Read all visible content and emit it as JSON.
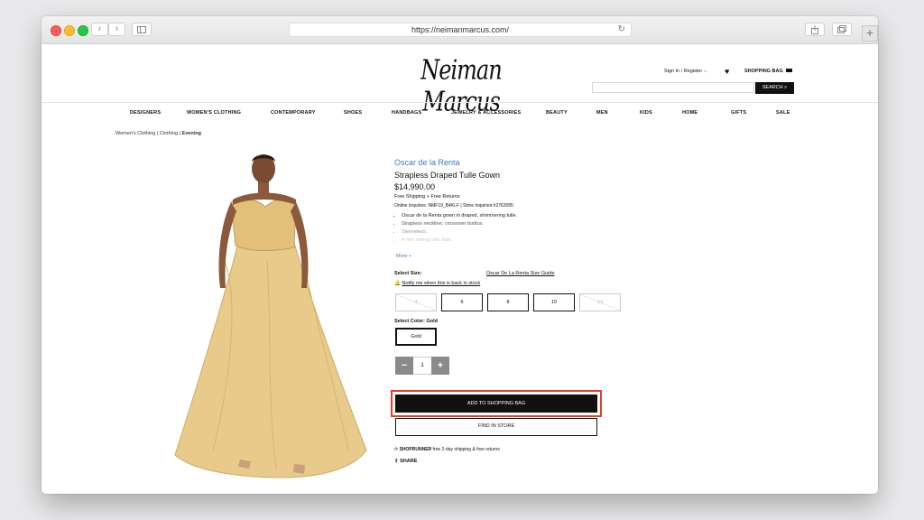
{
  "browser": {
    "url": "https://neimanmarcus.com/",
    "back_icon": "chevron-left-icon",
    "forward_icon": "chevron-right-icon",
    "sidebar_icon": "sidebar-icon",
    "reload_icon": "reload-icon",
    "share_icon": "share-icon",
    "tabs_icon": "tabs-icon",
    "new_tab_label": "+"
  },
  "header": {
    "logo": "Neiman Marcus",
    "sign_in": "Sign In / Register ⌵",
    "heart_icon": "♥",
    "shopping_bag": "SHOPPING BAG",
    "search_button": "SEARCH ⌕"
  },
  "nav": {
    "items": [
      "DESIGNERS",
      "WOMEN'S CLOTHING",
      "CONTEMPORARY",
      "SHOES",
      "HANDBAGS",
      "JEWELRY & ACCESSORIES",
      "BEAUTY",
      "MEN",
      "KIDS",
      "HOME",
      "GIFTS",
      "SALE"
    ]
  },
  "breadcrumb": {
    "items": [
      "Women's Clothing",
      "Clothing",
      "Evening"
    ],
    "separator": "|"
  },
  "product": {
    "brand": "Oscar de la Renta",
    "name": "Strapless Draped Tulle Gown",
    "price": "$14,990.00",
    "shipping": "Free Shipping + Free Returns",
    "inquiries": "Online Inquiries: NMF19_B4KLF   |   Store Inquiries:#2763095",
    "bullets": [
      "Oscar de la Renta gown in draped, shimmering tulle.",
      "Strapless neckline; crossover bodice.",
      "Sleeveless.",
      "A-line sweep with train."
    ],
    "more_link": "More +",
    "select_size_label": "Select Size:",
    "size_guide_link": "Oscar De La Renta Size Guide",
    "notify_link": "Notify me when this is back in stock",
    "sizes": [
      "4",
      "6",
      "8",
      "10",
      "14"
    ],
    "select_color_label": "Select Color: Gold",
    "color_option": "Gold",
    "quantity": "1",
    "qty_minus": "−",
    "qty_plus": "+",
    "add_to_bag": "ADD TO SHOPPING BAG",
    "find_in_store": "FIND IN STORE",
    "shoprunner_brand": "SHOPRUNNER",
    "shoprunner_text": "free 2-day shipping & free returns",
    "share": "SHARE"
  },
  "colors": {
    "brand_link": "#3d7cc0",
    "highlight": "#e33f26",
    "gown_gold": "#e6c88a"
  }
}
